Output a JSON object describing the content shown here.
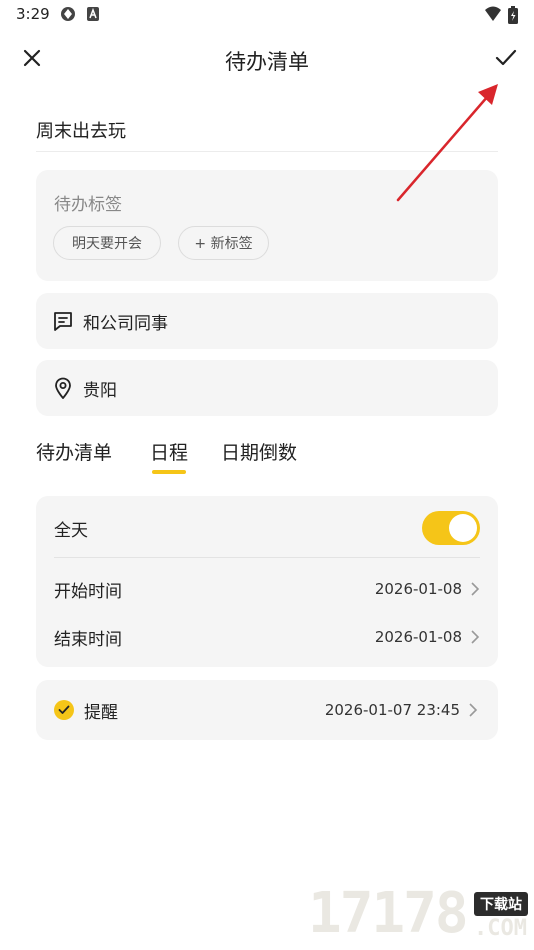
{
  "status_bar": {
    "time": "3:29",
    "icons": [
      "sync-icon",
      "a-badge-icon",
      "wifi-icon",
      "battery-icon"
    ]
  },
  "header": {
    "title": "待办清单",
    "close_icon": "close-icon",
    "confirm_icon": "check-icon"
  },
  "title_input": {
    "value": "周末出去玩"
  },
  "tags": {
    "label": "待办标签",
    "chips": [
      "明天要开会",
      "+ 新标签"
    ]
  },
  "note": {
    "icon": "note-icon",
    "text": "和公司同事"
  },
  "location": {
    "icon": "location-pin-icon",
    "text": "贵阳"
  },
  "tabs": {
    "items": [
      "待办清单",
      "日程",
      "日期倒数"
    ],
    "active_index": 1
  },
  "schedule": {
    "all_day_label": "全天",
    "all_day_on": true,
    "start_label": "开始时间",
    "start_value": "2026-01-08",
    "end_label": "结束时间",
    "end_value": "2026-01-08"
  },
  "reminder": {
    "checked": true,
    "label": "提醒",
    "value": "2026-01-07 23:45"
  },
  "watermark": {
    "number": "17178",
    "badge": "下载站",
    "suffix": ".COM"
  },
  "colors": {
    "accent": "#f5c518",
    "card_bg": "#f5f5f5",
    "annotation_arrow": "#d9262c"
  }
}
